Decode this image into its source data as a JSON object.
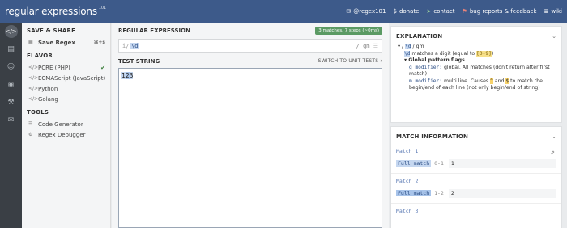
{
  "header": {
    "logo": "regular expressions",
    "logo_sup": "101",
    "nav": [
      {
        "icon": "twitter-icon",
        "glyph": "✉",
        "label": "@regex101"
      },
      {
        "icon": "dollar-icon",
        "glyph": "$",
        "label": "donate"
      },
      {
        "icon": "send-icon",
        "glyph": "➤",
        "label": "contact"
      },
      {
        "icon": "bug-icon",
        "glyph": "⚑",
        "label": "bug reports & feedback"
      },
      {
        "icon": "wiki-icon",
        "glyph": "≣",
        "label": "wiki"
      }
    ]
  },
  "rail": [
    {
      "name": "regex-editor-icon",
      "glyph": "</>",
      "active": true
    },
    {
      "name": "library-icon",
      "glyph": "▤"
    },
    {
      "name": "account-icon",
      "glyph": "☺"
    },
    {
      "name": "quiz-icon",
      "glyph": "◉"
    },
    {
      "name": "settings-icon",
      "glyph": "⚒"
    },
    {
      "name": "chat-icon",
      "glyph": "✉"
    }
  ],
  "sidebar": {
    "save_share_title": "SAVE & SHARE",
    "save_regex": "Save Regex",
    "save_shortcut": "⌘+s",
    "flavor_title": "FLAVOR",
    "flavors": [
      {
        "label": "PCRE (PHP)",
        "selected": true
      },
      {
        "label": "ECMAScript (JavaScript)"
      },
      {
        "label": "Python"
      },
      {
        "label": "Golang"
      }
    ],
    "tools_title": "TOOLS",
    "tools": [
      {
        "label": "Code Generator",
        "icon": "code-generator-icon",
        "glyph": "☰"
      },
      {
        "label": "Regex Debugger",
        "icon": "debugger-icon",
        "glyph": "⚙"
      }
    ]
  },
  "main": {
    "regex_title": "REGULAR EXPRESSION",
    "badge": "3 matches, 7 steps (~0ms)",
    "delimiter": "i/",
    "pattern": "\\d",
    "flags": "/ gm",
    "test_title": "TEST STRING",
    "switch_label": "SWITCH TO UNIT TESTS ›",
    "test_string": {
      "m1": "1",
      "m2": "2",
      "rest": "3"
    }
  },
  "explanation": {
    "title": "EXPLANATION",
    "line1_prefix": "▾ / ",
    "line1_token": "\\d",
    "line1_suffix": " / gm",
    "line2_token": "\\d",
    "line2_text": " matches a digit (equal to ",
    "line2_range": "[0-9]",
    "line2_end": ")",
    "flags_title": "▾ Global pattern flags",
    "g_mod": "g modifier:",
    "g_text": " global. All matches (don't return after first match)",
    "m_mod": "m modifier:",
    "m_text_a": " multi line. Causes ",
    "m_caret": "^",
    "m_text_b": " and ",
    "m_dollar": "$",
    "m_text_c": " to match the begin/end of each line (not only begin/end of string)"
  },
  "match_info": {
    "title": "MATCH INFORMATION",
    "matches": [
      {
        "title": "Match 1",
        "full": "Full match",
        "range": "0-1",
        "value": "1"
      },
      {
        "title": "Match 2",
        "full": "Full match",
        "range": "1-2",
        "value": "2"
      },
      {
        "title": "Match 3"
      }
    ]
  }
}
